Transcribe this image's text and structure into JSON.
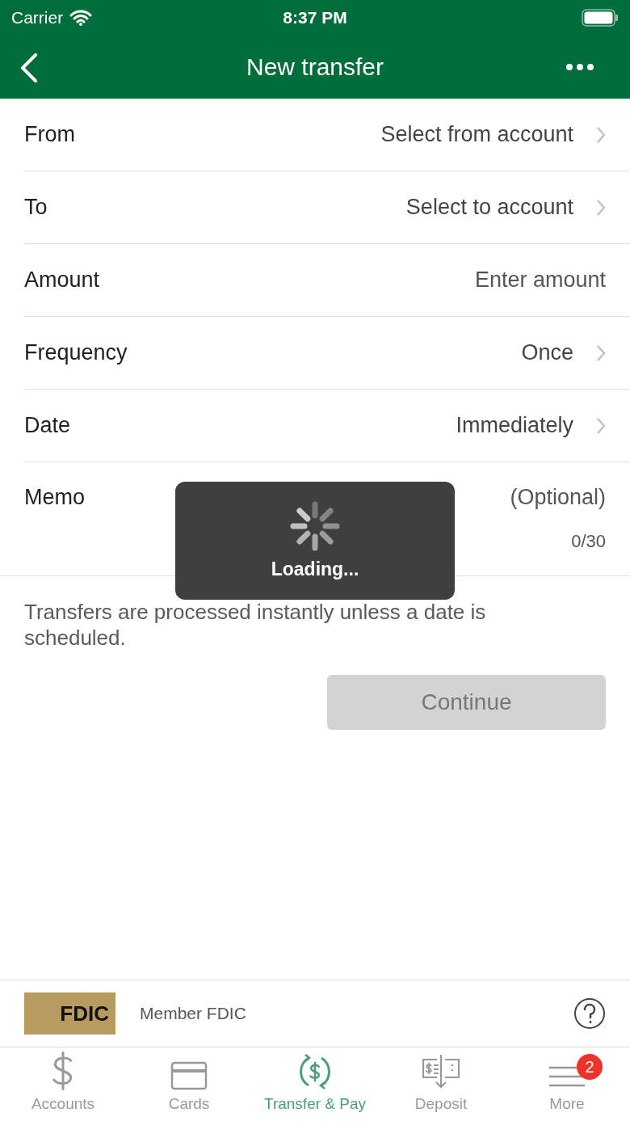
{
  "status_bar": {
    "carrier": "Carrier",
    "time": "8:37 PM"
  },
  "nav": {
    "title": "New transfer"
  },
  "rows": [
    {
      "kind": "select",
      "label": "From",
      "value": "Select from account"
    },
    {
      "kind": "select",
      "label": "To",
      "value": "Select to account"
    },
    {
      "kind": "input",
      "label": "Amount",
      "placeholder": "Enter amount"
    },
    {
      "kind": "select",
      "label": "Frequency",
      "value": "Once"
    },
    {
      "kind": "select",
      "label": "Date",
      "value": "Immediately"
    },
    {
      "kind": "memo",
      "label": "Memo",
      "placeholder": "(Optional)",
      "counter": "0/30"
    }
  ],
  "note": "Transfers are processed instantly unless a date is scheduled.",
  "continue_button": {
    "label": "Continue",
    "disabled": true
  },
  "loading": {
    "label": "Loading..."
  },
  "footer": {
    "logo_text": "FDIC",
    "label": "Member FDIC"
  },
  "tabs": [
    {
      "label": "Accounts",
      "selected": false
    },
    {
      "label": "Cards",
      "selected": false
    },
    {
      "label": "Transfer & Pay",
      "selected": true
    },
    {
      "label": "Deposit",
      "selected": false
    },
    {
      "label": "More",
      "selected": false,
      "badge": "2"
    }
  ]
}
